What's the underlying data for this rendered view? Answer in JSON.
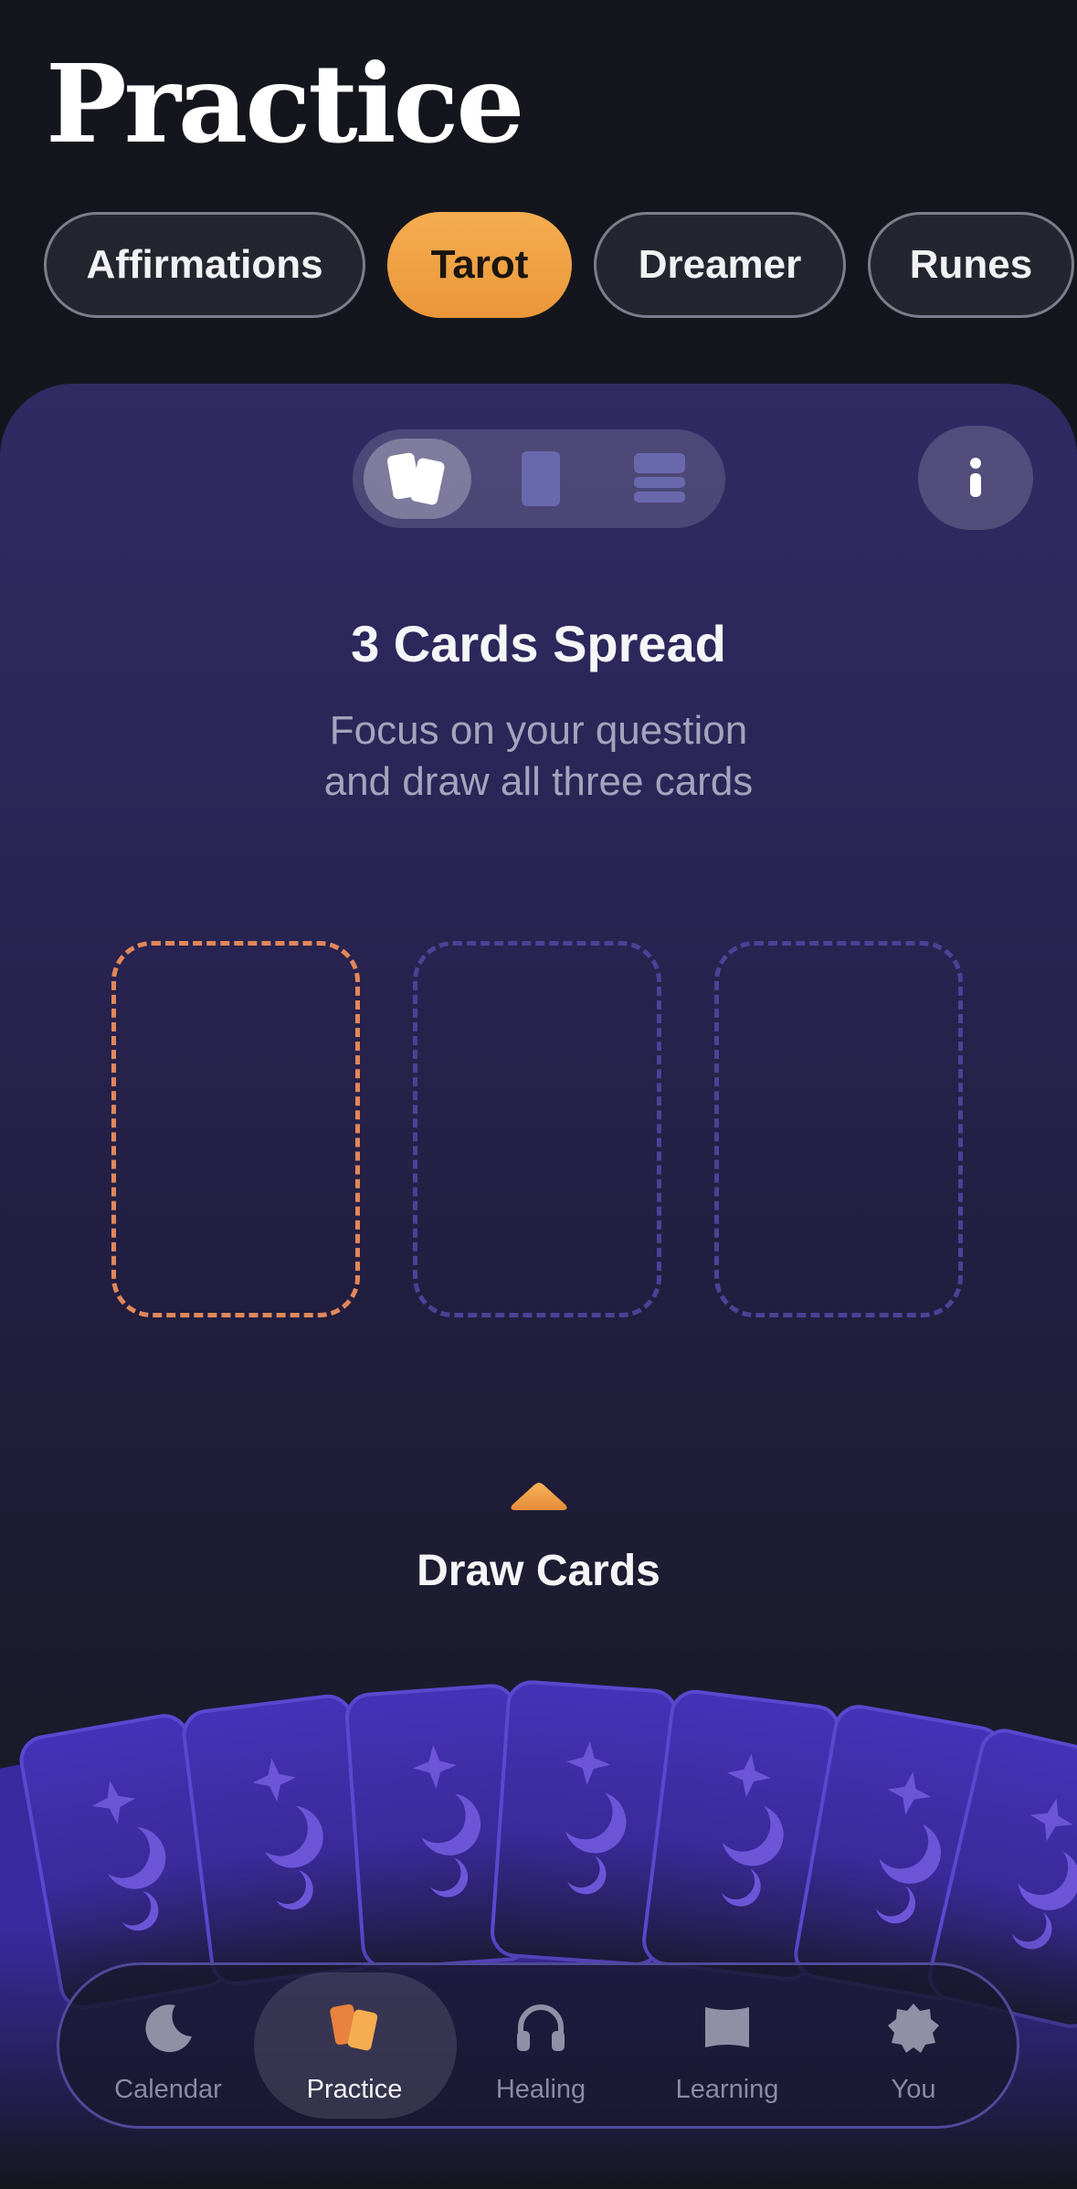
{
  "page": {
    "title": "Practice"
  },
  "tabs": [
    {
      "label": "Affirmations",
      "active": false
    },
    {
      "label": "Tarot",
      "active": true
    },
    {
      "label": "Dreamer",
      "active": false
    },
    {
      "label": "Runes",
      "active": false
    }
  ],
  "spread": {
    "modes": [
      "three-cards-icon",
      "single-card-icon",
      "stack-icon"
    ],
    "title": "3 Cards Spread",
    "subtitle_line1": "Focus on your question",
    "subtitle_line2": "and draw all three cards",
    "draw_label": "Draw Cards"
  },
  "nav": [
    {
      "label": "Calendar",
      "icon": "moon-icon",
      "active": false
    },
    {
      "label": "Practice",
      "icon": "cards-icon",
      "active": true
    },
    {
      "label": "Healing",
      "icon": "headphones-icon",
      "active": false
    },
    {
      "label": "Learning",
      "icon": "book-icon",
      "active": false
    },
    {
      "label": "You",
      "icon": "badge-icon",
      "active": false
    }
  ],
  "colors": {
    "accent": "#f0a346",
    "slot_highlight": "#e2875a",
    "slot_default": "#4b4296",
    "card_back": "#3c2aa6"
  }
}
